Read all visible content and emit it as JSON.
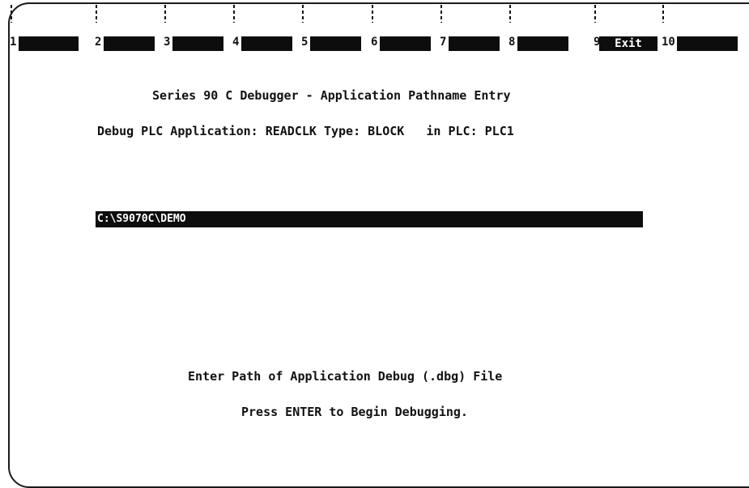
{
  "function_keys": [
    {
      "number": "1",
      "label": ""
    },
    {
      "number": "2",
      "label": ""
    },
    {
      "number": "3",
      "label": ""
    },
    {
      "number": "4",
      "label": ""
    },
    {
      "number": "5",
      "label": ""
    },
    {
      "number": "6",
      "label": ""
    },
    {
      "number": "7",
      "label": ""
    },
    {
      "number": "8",
      "label": ""
    },
    {
      "number": "9",
      "label": "Exit"
    },
    {
      "number": "10",
      "label": ""
    }
  ],
  "screen": {
    "title": "Series 90 C Debugger - Application Pathname Entry",
    "debug_line": "Debug PLC Application: READCLK Type: BLOCK   in PLC: PLC1",
    "path_value": "C:\\S9070C\\DEMO",
    "prompt": "Enter Path of Application Debug (.dbg) File",
    "enter_hint": "Press ENTER to Begin Debugging."
  },
  "colors": {
    "foreground": "#111111",
    "highlight_bg": "#0d0d0d",
    "highlight_fg": "#ffffff",
    "background": "#ffffff"
  }
}
